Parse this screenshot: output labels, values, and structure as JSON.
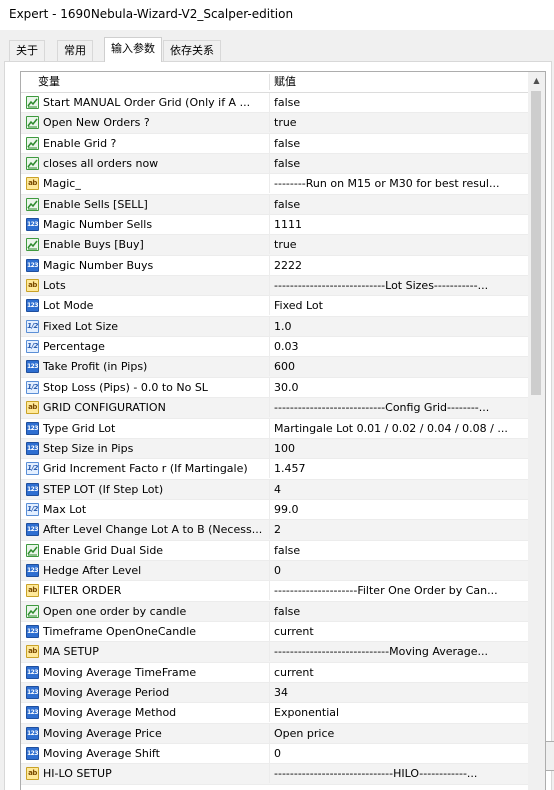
{
  "window": {
    "title": "Expert - 1690Nebula-Wizard-V2_Scalper-edition"
  },
  "tabs": [
    {
      "label": "关于",
      "active": false
    },
    {
      "label": "常用",
      "active": false
    },
    {
      "label": "输入参数",
      "active": true
    },
    {
      "label": "依存关系",
      "active": false
    }
  ],
  "grid": {
    "col_variable": "变量",
    "col_value": "赋值",
    "rows": [
      {
        "icon": "bool-icon",
        "name": "Start MANUAL Order  Grid  (Only if A ...",
        "value": "false"
      },
      {
        "icon": "bool-icon",
        "name": "Open New Orders ?",
        "value": "true"
      },
      {
        "icon": "bool-icon",
        "name": "Enable Grid ?",
        "value": "false"
      },
      {
        "icon": "bool-icon",
        "name": "closes all orders now",
        "value": "false"
      },
      {
        "icon": "string-icon",
        "name": "Magic_",
        "value": "--------Run on M15 or M30 for best resul..."
      },
      {
        "icon": "bool-icon",
        "name": "Enable Sells   [SELL]",
        "value": "false"
      },
      {
        "icon": "int-icon",
        "name": "Magic Number Sells",
        "value": "1111"
      },
      {
        "icon": "bool-icon",
        "name": "Enable Buys   [Buy]",
        "value": "true"
      },
      {
        "icon": "int-icon",
        "name": "Magic Number Buys",
        "value": "2222"
      },
      {
        "icon": "string-icon",
        "name": "Lots",
        "value": "----------------------------Lot Sizes-----------..."
      },
      {
        "icon": "int-icon",
        "name": "Lot Mode",
        "value": "Fixed Lot"
      },
      {
        "icon": "double-icon",
        "name": "Fixed Lot Size",
        "value": "1.0"
      },
      {
        "icon": "double-icon",
        "name": "Percentage",
        "value": "0.03"
      },
      {
        "icon": "int-icon",
        "name": "Take Profit (in Pips)",
        "value": "600"
      },
      {
        "icon": "double-icon",
        "name": "Stop Loss (Pips) - 0.0 to No SL",
        "value": "30.0"
      },
      {
        "icon": "string-icon",
        "name": "GRID CONFIGURATION",
        "value": "----------------------------Config Grid--------..."
      },
      {
        "icon": "int-icon",
        "name": "Type Grid Lot",
        "value": "Martingale Lot  0.01 / 0.02 / 0.04 / 0.08 / ..."
      },
      {
        "icon": "int-icon",
        "name": "Step Size in Pips",
        "value": "100"
      },
      {
        "icon": "double-icon",
        "name": "Grid Increment Facto r (If Martingale)",
        "value": "1.457"
      },
      {
        "icon": "int-icon",
        "name": "STEP LOT (If  Step Lot)",
        "value": "4"
      },
      {
        "icon": "double-icon",
        "name": "Max Lot",
        "value": "99.0"
      },
      {
        "icon": "int-icon",
        "name": "After Level Change Lot A to B (Necess...",
        "value": "2"
      },
      {
        "icon": "bool-icon",
        "name": "Enable Grid Dual Side",
        "value": "false"
      },
      {
        "icon": "int-icon",
        "name": "Hedge After Level",
        "value": "0"
      },
      {
        "icon": "string-icon",
        "name": "FILTER ORDER",
        "value": "---------------------Filter One Order by Can..."
      },
      {
        "icon": "bool-icon",
        "name": "Open one order by candle",
        "value": "false"
      },
      {
        "icon": "int-icon",
        "name": "Timeframe OpenOneCandle",
        "value": "current"
      },
      {
        "icon": "string-icon",
        "name": "MA SETUP",
        "value": "-----------------------------Moving Average..."
      },
      {
        "icon": "int-icon",
        "name": "Moving Average TimeFrame",
        "value": "current"
      },
      {
        "icon": "int-icon",
        "name": "Moving Average Period",
        "value": "34"
      },
      {
        "icon": "int-icon",
        "name": "Moving Average Method",
        "value": "Exponential"
      },
      {
        "icon": "int-icon",
        "name": "Moving Average Price",
        "value": "Open price"
      },
      {
        "icon": "int-icon",
        "name": "Moving Average Shift",
        "value": "0"
      },
      {
        "icon": "string-icon",
        "name": "HI-LO SETUP",
        "value": "------------------------------HILO------------..."
      }
    ]
  }
}
